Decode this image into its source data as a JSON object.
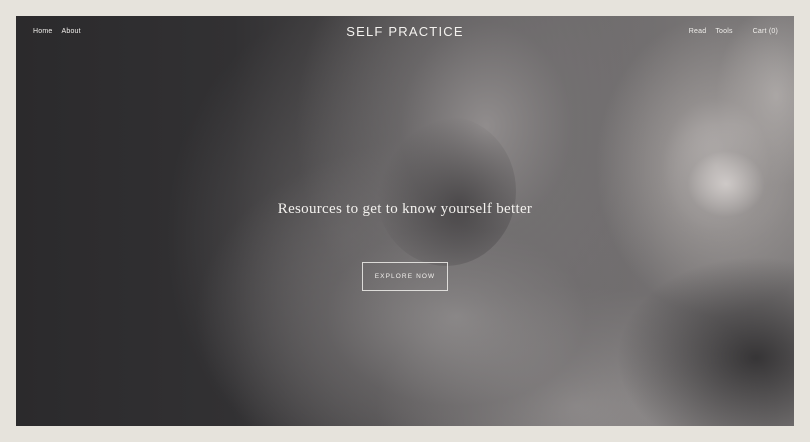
{
  "header": {
    "brand": "SELF PRACTICE",
    "nav_left": [
      {
        "label": "Home"
      },
      {
        "label": "About"
      }
    ],
    "nav_right": [
      {
        "label": "Read"
      },
      {
        "label": "Tools"
      }
    ],
    "cart_label": "Cart (0)"
  },
  "hero": {
    "tagline": "Resources to get to know yourself better",
    "cta_label": "EXPLORE NOW",
    "image_icon": "photo-hero-image"
  },
  "colors": {
    "page_border": "#e6e3dc",
    "hero_dark": "#2e2d2f",
    "text_light": "#f3f1ee"
  }
}
